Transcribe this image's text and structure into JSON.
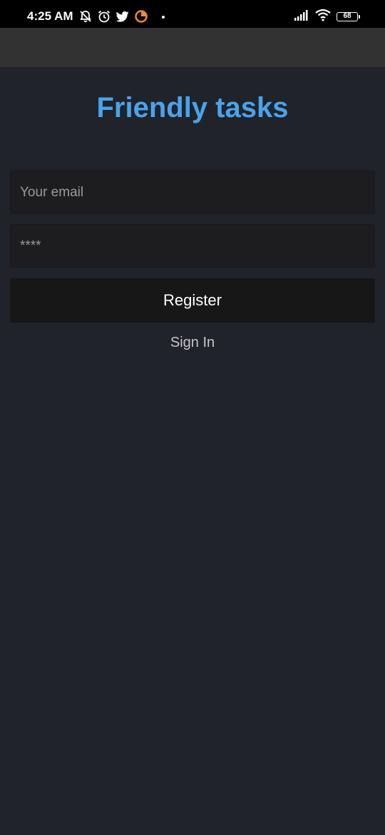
{
  "status_bar": {
    "time": "4:25 AM",
    "battery_level": "68",
    "left_icons": [
      "notifications-off-icon",
      "alarm-icon",
      "twitter-icon",
      "pie-app-icon",
      "dot-icon"
    ],
    "right_icons": [
      "signal-icon",
      "wifi-icon",
      "battery-icon"
    ]
  },
  "app": {
    "title": "Friendly tasks",
    "title_color": "#4aa3ec"
  },
  "form": {
    "email_placeholder": "Your email",
    "password_placeholder": "****",
    "register_label": "Register",
    "signin_label": "Sign In"
  },
  "colors": {
    "background": "#202329",
    "app_bar": "#323232",
    "input_background": "#1d1d1f",
    "button_background": "#171717"
  }
}
